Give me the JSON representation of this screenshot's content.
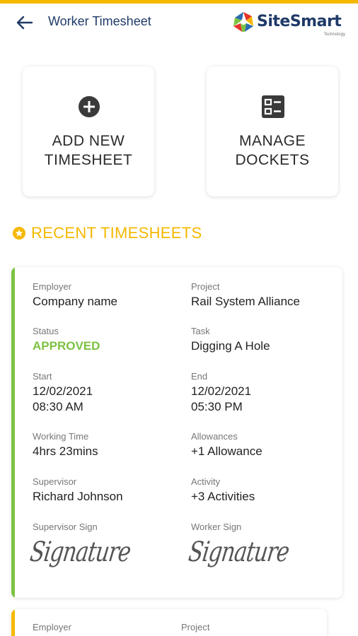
{
  "header": {
    "title": "Worker Timesheet",
    "logo_text": "SiteSmart",
    "logo_sub": "Technology",
    "back_icon": "arrow-left-icon"
  },
  "actions": [
    {
      "icon": "plus-circle-icon",
      "line1": "ADD NEW",
      "line2": "TIMESHEET"
    },
    {
      "icon": "dockets-list-icon",
      "line1": "MANAGE",
      "line2": "DOCKETS"
    }
  ],
  "section": {
    "icon": "star-circle-icon",
    "title": "RECENT TIMESHEETS"
  },
  "colors": {
    "accent": "#f5b800",
    "approved": "#7cc242",
    "navy": "#1f3a68"
  },
  "timesheets": [
    {
      "stripe_color": "#7cc242",
      "employer_label": "Employer",
      "employer": "Company name",
      "project_label": "Project",
      "project": "Rail System Alliance",
      "status_label": "Status",
      "status": "APPROVED",
      "task_label": "Task",
      "task": "Digging A Hole",
      "start_label": "Start",
      "start_date": "12/02/2021",
      "start_time": "08:30 AM",
      "end_label": "End",
      "end_date": "12/02/2021",
      "end_time": "05:30 PM",
      "working_time_label": "Working Time",
      "working_time": "4hrs 23mins",
      "allowances_label": "Allowances",
      "allowances": "+1 Allowance",
      "supervisor_label": "Supervisor",
      "supervisor": "Richard Johnson",
      "activity_label": "Activity",
      "activity": "+3 Activities",
      "supervisor_sign_label": "Supervisor Sign",
      "worker_sign_label": "Worker Sign",
      "signature_text": "Signature"
    },
    {
      "stripe_color": "#f5b800",
      "employer_label": "Employer",
      "project_label": "Project"
    }
  ]
}
